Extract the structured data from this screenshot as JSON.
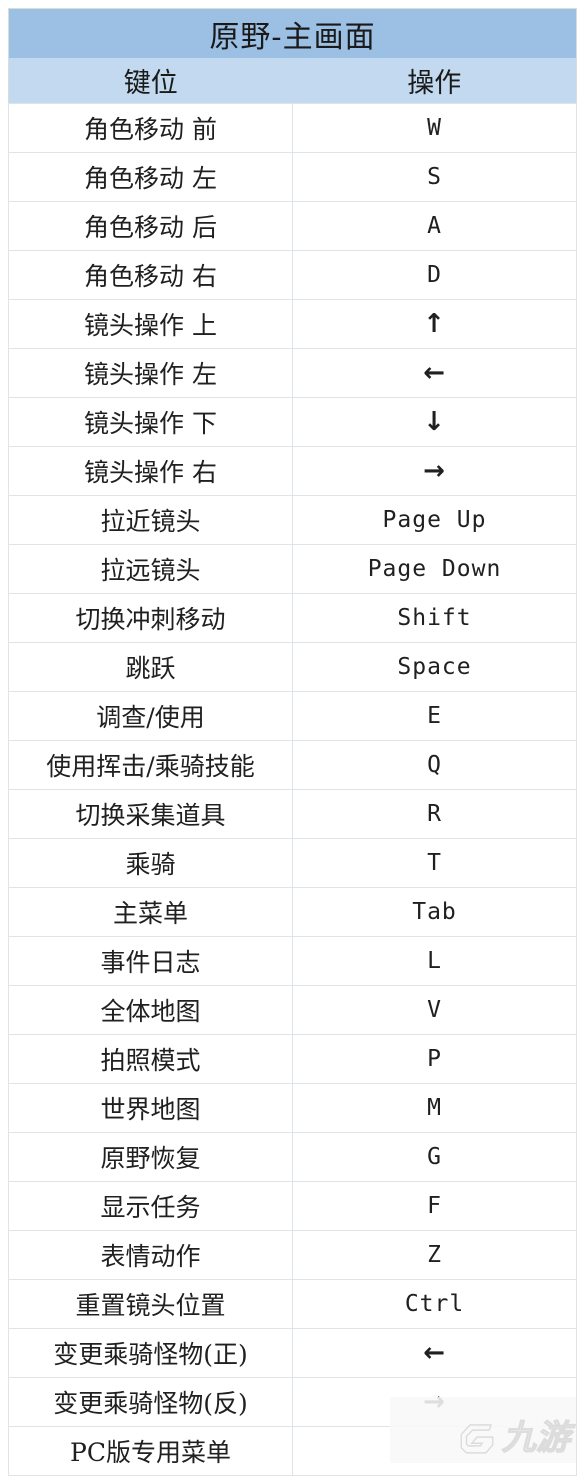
{
  "sheet": {
    "title": "原野-主画面",
    "columns": [
      "键位",
      "操作"
    ],
    "rows": [
      {
        "action": "角色移动 前",
        "key": "W",
        "key_type": "text"
      },
      {
        "action": "角色移动 左",
        "key": "S",
        "key_type": "text"
      },
      {
        "action": "角色移动 后",
        "key": "A",
        "key_type": "text"
      },
      {
        "action": "角色移动 右",
        "key": "D",
        "key_type": "text"
      },
      {
        "action": "镜头操作 上",
        "key": "↑",
        "key_type": "arrow"
      },
      {
        "action": "镜头操作 左",
        "key": "←",
        "key_type": "arrow"
      },
      {
        "action": "镜头操作 下",
        "key": "↓",
        "key_type": "arrow"
      },
      {
        "action": "镜头操作 右",
        "key": "→",
        "key_type": "arrow"
      },
      {
        "action": "拉近镜头",
        "key": "Page Up",
        "key_type": "text"
      },
      {
        "action": "拉远镜头",
        "key": "Page Down",
        "key_type": "text"
      },
      {
        "action": "切换冲刺移动",
        "key": "Shift",
        "key_type": "text"
      },
      {
        "action": "跳跃",
        "key": "Space",
        "key_type": "text"
      },
      {
        "action": "调查/使用",
        "key": "E",
        "key_type": "text"
      },
      {
        "action": "使用挥击/乘骑技能",
        "key": "Q",
        "key_type": "text"
      },
      {
        "action": "切换采集道具",
        "key": "R",
        "key_type": "text"
      },
      {
        "action": "乘骑",
        "key": "T",
        "key_type": "text"
      },
      {
        "action": "主菜单",
        "key": "Tab",
        "key_type": "text"
      },
      {
        "action": "事件日志",
        "key": "L",
        "key_type": "text"
      },
      {
        "action": "全体地图",
        "key": "V",
        "key_type": "text"
      },
      {
        "action": "拍照模式",
        "key": "P",
        "key_type": "text"
      },
      {
        "action": "世界地图",
        "key": "M",
        "key_type": "text"
      },
      {
        "action": "原野恢复",
        "key": "G",
        "key_type": "text"
      },
      {
        "action": "显示任务",
        "key": "F",
        "key_type": "text"
      },
      {
        "action": "表情动作",
        "key": "Z",
        "key_type": "text"
      },
      {
        "action": "重置镜头位置",
        "key": "Ctrl",
        "key_type": "text"
      },
      {
        "action": "变更乘骑怪物(正)",
        "key": "←",
        "key_type": "arrow"
      },
      {
        "action": "变更乘骑怪物(反)",
        "key": "→",
        "key_type": "arrow"
      },
      {
        "action": "PC版专用菜单",
        "key": "",
        "key_type": "text"
      }
    ]
  },
  "watermark": {
    "text": "九游",
    "logo_icon": "g-logo-icon"
  },
  "colors": {
    "title_bg": "#9cc0e4",
    "header_bg": "#c3d9ef",
    "row_bg": "#ffffff",
    "grid_line": "#dfe4ea",
    "text": "#202020"
  }
}
